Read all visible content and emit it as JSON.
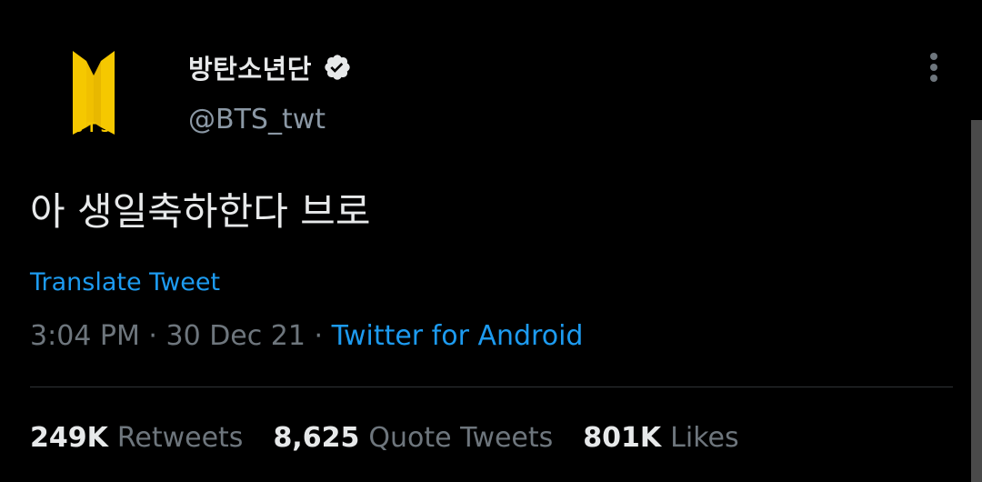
{
  "author": {
    "display_name": "방탄소년단",
    "handle": "@BTS_twt",
    "avatar_text": "BTS",
    "verified": true
  },
  "tweet": {
    "text": "아 생일축하한다 브로",
    "translate_label": "Translate Tweet",
    "time": "3:04 PM",
    "separator": " · ",
    "date": "30 Dec 21",
    "source": "Twitter for Android"
  },
  "stats": {
    "retweets_count": "249K",
    "retweets_label": "Retweets",
    "quotes_count": "8,625",
    "quotes_label": "Quote Tweets",
    "likes_count": "801K",
    "likes_label": "Likes"
  },
  "icons": {
    "avatar": "bts-logo-icon",
    "verified": "verified-badge-icon",
    "more": "more-options-icon"
  },
  "colors": {
    "background": "#000000",
    "text_primary": "#e7e9ea",
    "text_secondary": "#6e767d",
    "link": "#1d9bf0",
    "logo_yellow": "#f5c800"
  }
}
